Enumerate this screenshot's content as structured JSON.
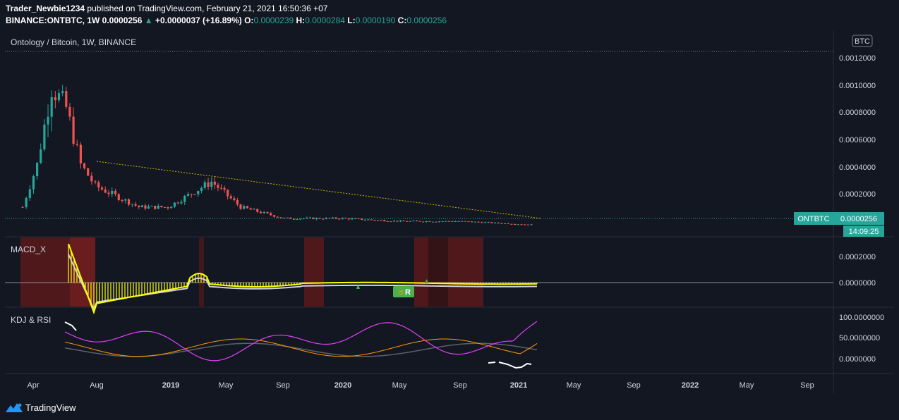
{
  "header": {
    "publisher": "Trader_Newbie1234",
    "published_text": "published on TradingView.com, February 21, 2021 16:50:36 +07",
    "symbol": "BINANCE:ONTBTC, 1W",
    "last": "0.0000256",
    "change": "+0.0000037 (+16.89%)",
    "o_label": "O:",
    "o_val": "0.0000239",
    "h_label": "H:",
    "h_val": "0.0000284",
    "l_label": "L:",
    "l_val": "0.0000190",
    "c_label": "C:",
    "c_val": "0.0000256"
  },
  "main_pane": {
    "title": "Ontology / Bitcoin, 1W, BINANCE",
    "currency_badge": "BTC",
    "price_ticks": [
      "0.0012000",
      "0.0010000",
      "0.0008000",
      "0.0006000",
      "0.0004000",
      "0.0002000"
    ],
    "last_price_label": "ONTBTC",
    "last_price_value": "0.0000256",
    "countdown": "14:09:25"
  },
  "macd_pane": {
    "title": "MACD_X",
    "ticks": [
      "0.0000000",
      "0.0002000"
    ],
    "badge_text": "R"
  },
  "kdj_pane": {
    "title": "KDJ & RSI",
    "ticks": [
      "100.0000000",
      "50.0000000",
      "0.0000000"
    ]
  },
  "time_axis": [
    "Apr",
    "Aug",
    "2019",
    "May",
    "Sep",
    "2020",
    "May",
    "Sep",
    "2021",
    "May",
    "Sep",
    "2022",
    "May",
    "Sep"
  ],
  "footer": {
    "brand": "TradingView"
  },
  "colors": {
    "background": "#131722",
    "up": "#26a69a",
    "down": "#ef5350",
    "macd_hist": "#ffff00",
    "kdj_k": "#e040fb",
    "kdj_d": "#ff9800",
    "kdj_j": "#787b86"
  },
  "chart_data": {
    "type": "candlestick",
    "title": "Ontology / Bitcoin, 1W, BINANCE",
    "interval": "1W",
    "y_unit": "BTC",
    "ylim": [
      0,
      0.00125
    ],
    "approx_close_path": [
      {
        "date": "2018-03",
        "price": 0.00015
      },
      {
        "date": "2018-04",
        "price": 0.00045
      },
      {
        "date": "2018-05",
        "price": 0.001
      },
      {
        "date": "2018-06",
        "price": 0.00085
      },
      {
        "date": "2018-07",
        "price": 0.00045
      },
      {
        "date": "2018-08",
        "price": 0.0003
      },
      {
        "date": "2018-11",
        "price": 0.00015
      },
      {
        "date": "2019-01",
        "price": 0.00015
      },
      {
        "date": "2019-04",
        "price": 0.00033
      },
      {
        "date": "2019-06",
        "price": 0.00015
      },
      {
        "date": "2019-09",
        "price": 7e-05
      },
      {
        "date": "2020-01",
        "price": 7e-05
      },
      {
        "date": "2020-05",
        "price": 5e-05
      },
      {
        "date": "2020-09",
        "price": 5e-05
      },
      {
        "date": "2021-02",
        "price": 2.56e-05
      }
    ]
  }
}
